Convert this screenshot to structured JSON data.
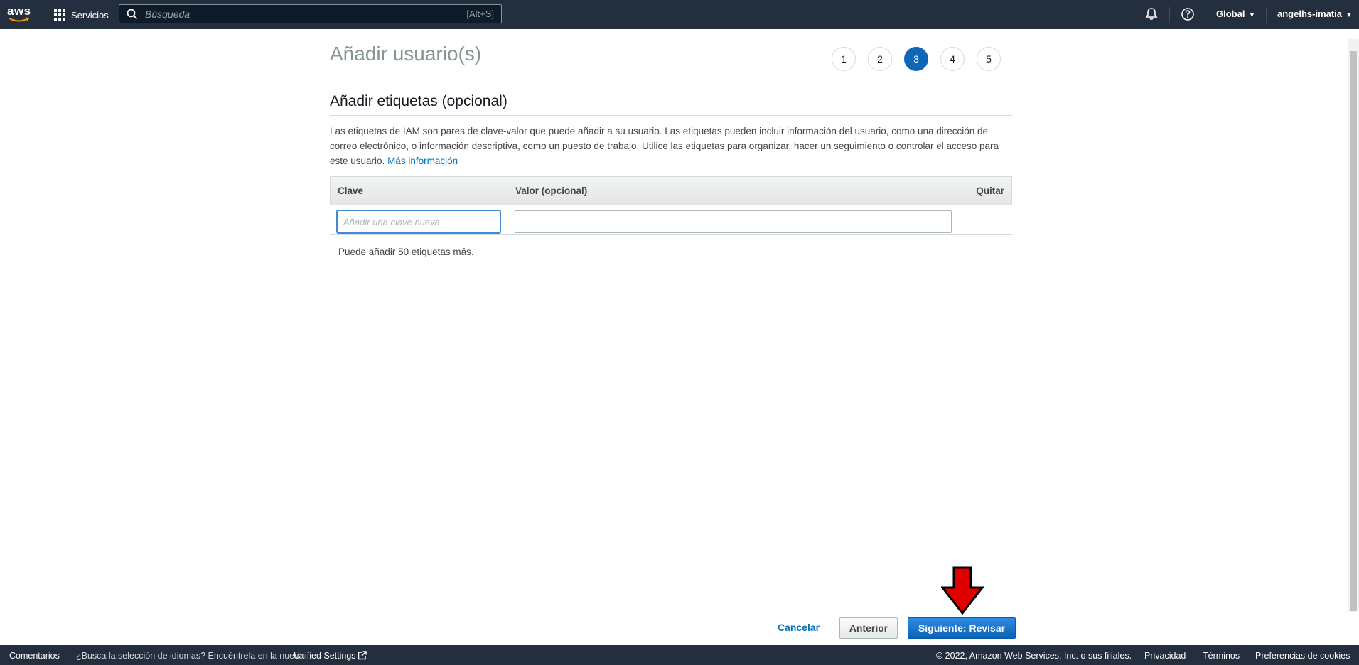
{
  "topnav": {
    "logo_text": "aws",
    "services_label": "Servicios",
    "search_placeholder": "Búsqueda",
    "search_shortcut": "[Alt+S]",
    "region_label": "Global",
    "account_label": "angelhs-imatia",
    "icons": [
      "grid-icon",
      "search-icon",
      "bell-icon",
      "help-icon",
      "caret-down-icon"
    ]
  },
  "page": {
    "title": "Añadir usuario(s)",
    "steps": [
      "1",
      "2",
      "3",
      "4",
      "5"
    ],
    "active_step": "3",
    "section_title": "Añadir etiquetas (opcional)",
    "description": "Las etiquetas de IAM son pares de clave-valor que puede añadir a su usuario. Las etiquetas pueden incluir información del usuario, como una dirección de correo electrónico, o información descriptiva, como un puesto de trabajo. Utilice las etiquetas para organizar, hacer un seguimiento o controlar el acceso para este usuario.",
    "more_info_link": "Más información",
    "table": {
      "col_key": "Clave",
      "col_value": "Valor (opcional)",
      "col_remove": "Quitar",
      "key_placeholder": "Añadir una clave nueva",
      "value_value": ""
    },
    "remaining_text": "Puede añadir 50 etiquetas más."
  },
  "actions": {
    "cancel": "Cancelar",
    "previous": "Anterior",
    "next": "Siguiente: Revisar"
  },
  "footer": {
    "feedback": "Comentarios",
    "language_prompt": "¿Busca la selección de idiomas? Encuéntrela en la nueva",
    "unified_settings": "Unified Settings",
    "copyright": "© 2022, Amazon Web Services, Inc. o sus filiales.",
    "privacy": "Privacidad",
    "terms": "Términos",
    "cookies": "Preferencias de cookies"
  },
  "colors": {
    "nav_bg": "#232f3e",
    "primary": "#0d67b5",
    "link": "#0073bb",
    "annotation_arrow": "#e00000"
  }
}
